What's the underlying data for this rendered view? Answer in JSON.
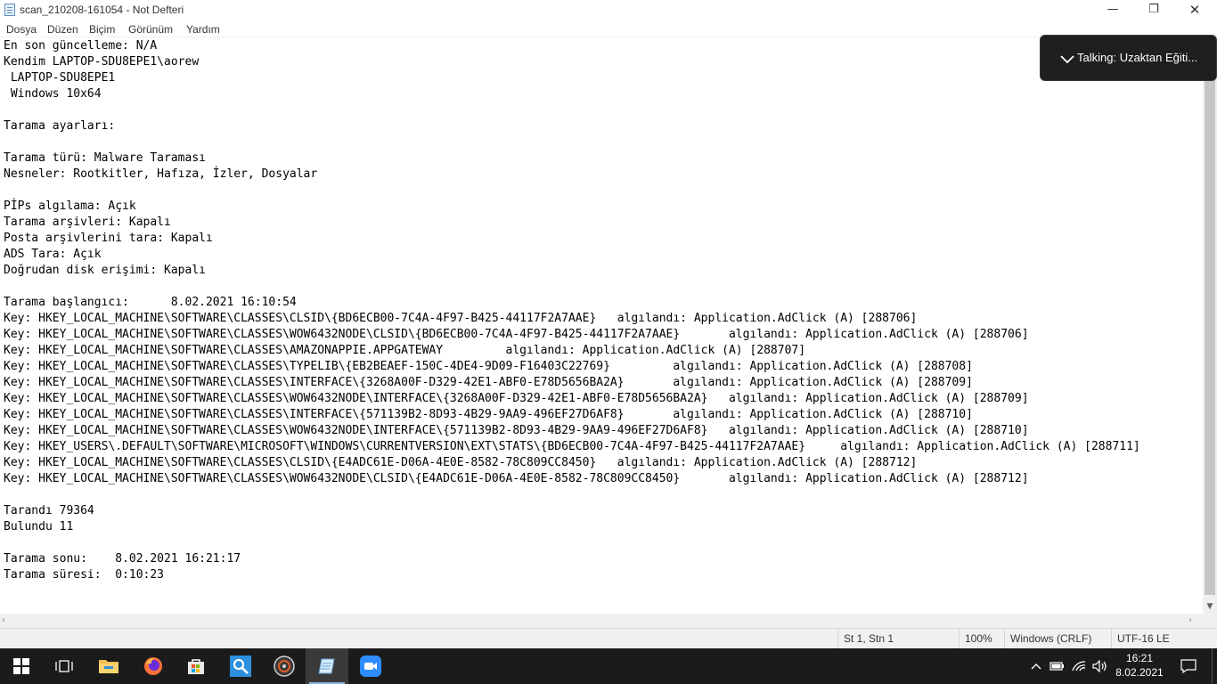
{
  "window": {
    "title": "scan_210208-161054 - Not Defteri",
    "minimize_glyph": "—",
    "maximize_glyph": "❐",
    "close_glyph": "✕"
  },
  "menu": {
    "items": [
      "Dosya",
      "Düzen",
      "Biçim",
      "Görünüm",
      "Yardım"
    ]
  },
  "editor": {
    "lines": [
      "En son güncelleme: N/A",
      "Kendim LAPTOP-SDU8EPE1\\aorew",
      " LAPTOP-SDU8EPE1",
      " Windows 10x64",
      "",
      "Tarama ayarları:",
      "",
      "Tarama türü: Malware Taraması",
      "Nesneler: Rootkitler, Hafıza, İzler, Dosyalar",
      "",
      "PİPs algılama: Açık",
      "Tarama arşivleri: Kapalı",
      "Posta arşivlerini tara: Kapalı",
      "ADS Tara: Açık",
      "Doğrudan disk erişimi: Kapalı",
      "",
      "Tarama başlangıcı:      8.02.2021 16:10:54",
      "Key: HKEY_LOCAL_MACHINE\\SOFTWARE\\CLASSES\\CLSID\\{BD6ECB00-7C4A-4F97-B425-44117F2A7AAE}   algılandı: Application.AdClick (A) [288706]",
      "Key: HKEY_LOCAL_MACHINE\\SOFTWARE\\CLASSES\\WOW6432NODE\\CLSID\\{BD6ECB00-7C4A-4F97-B425-44117F2A7AAE}       algılandı: Application.AdClick (A) [288706]",
      "Key: HKEY_LOCAL_MACHINE\\SOFTWARE\\CLASSES\\AMAZONAPPIE.APPGATEWAY         algılandı: Application.AdClick (A) [288707]",
      "Key: HKEY_LOCAL_MACHINE\\SOFTWARE\\CLASSES\\TYPELIB\\{EB2BEAEF-150C-4DE4-9D09-F16403C22769}         algılandı: Application.AdClick (A) [288708]",
      "Key: HKEY_LOCAL_MACHINE\\SOFTWARE\\CLASSES\\INTERFACE\\{3268A00F-D329-42E1-ABF0-E78D5656BA2A}       algılandı: Application.AdClick (A) [288709]",
      "Key: HKEY_LOCAL_MACHINE\\SOFTWARE\\CLASSES\\WOW6432NODE\\INTERFACE\\{3268A00F-D329-42E1-ABF0-E78D5656BA2A}   algılandı: Application.AdClick (A) [288709]",
      "Key: HKEY_LOCAL_MACHINE\\SOFTWARE\\CLASSES\\INTERFACE\\{571139B2-8D93-4B29-9AA9-496EF27D6AF8}       algılandı: Application.AdClick (A) [288710]",
      "Key: HKEY_LOCAL_MACHINE\\SOFTWARE\\CLASSES\\WOW6432NODE\\INTERFACE\\{571139B2-8D93-4B29-9AA9-496EF27D6AF8}   algılandı: Application.AdClick (A) [288710]",
      "Key: HKEY_USERS\\.DEFAULT\\SOFTWARE\\MICROSOFT\\WINDOWS\\CURRENTVERSION\\EXT\\STATS\\{BD6ECB00-7C4A-4F97-B425-44117F2A7AAE}     algılandı: Application.AdClick (A) [288711]",
      "Key: HKEY_LOCAL_MACHINE\\SOFTWARE\\CLASSES\\CLSID\\{E4ADC61E-D06A-4E0E-8582-78C809CC8450}   algılandı: Application.AdClick (A) [288712]",
      "Key: HKEY_LOCAL_MACHINE\\SOFTWARE\\CLASSES\\WOW6432NODE\\CLSID\\{E4ADC61E-D06A-4E0E-8582-78C809CC8450}       algılandı: Application.AdClick (A) [288712]",
      "",
      "Tarandı 79364",
      "Bulundu 11",
      "",
      "Tarama sonu:    8.02.2021 16:21:17",
      "Tarama süresi:  0:10:23"
    ]
  },
  "statusbar": {
    "position": "St 1, Stn 1",
    "zoom": "100%",
    "line_ending": "Windows (CRLF)",
    "encoding": "UTF-16 LE"
  },
  "notification": {
    "text": "Talking: Uzaktan Eğiti..."
  },
  "taskbar": {
    "time": "16:21",
    "date": "8.02.2021"
  },
  "colors": {
    "taskbar_bg": "#1b1b1b",
    "toast_bg": "#1f1f1f",
    "statusbar_bg": "#f0f0f0"
  }
}
